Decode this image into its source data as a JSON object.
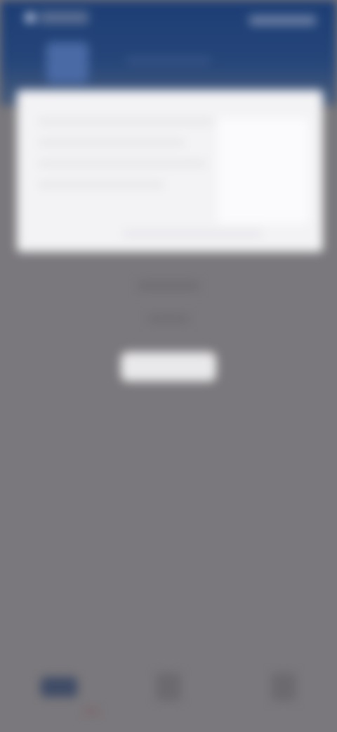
{
  "status_bar": {
    "time": "",
    "indicators": ""
  },
  "header": {
    "tabs": [
      {
        "label": "",
        "active": true
      },
      {
        "label": "",
        "active": false
      }
    ]
  },
  "card": {
    "text": ""
  },
  "content": {
    "line_1": "",
    "line_2": "",
    "button_label": ""
  },
  "bottom_nav": {
    "items": [
      {
        "label": "",
        "active": true
      },
      {
        "label": "",
        "active": false
      },
      {
        "label": "",
        "active": false
      }
    ]
  },
  "colors": {
    "header": "#1c3d74",
    "backdrop": "#7a787c",
    "card": "#f3f3f5",
    "button": "#e9e8ea"
  }
}
